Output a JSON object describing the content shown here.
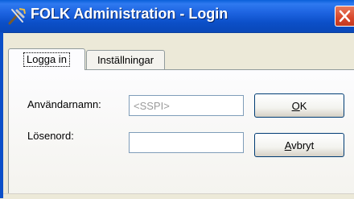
{
  "window": {
    "title": "FOLK Administration - Login",
    "app_icon": "tools-icon",
    "close_icon": "close-icon"
  },
  "tabs": [
    {
      "label": "Logga in",
      "active": true
    },
    {
      "label": "Inställningar",
      "active": false
    }
  ],
  "form": {
    "username_label": "Användarnamn:",
    "username_value": "<SSPI>",
    "password_label": "Lösenord:",
    "password_value": ""
  },
  "buttons": {
    "ok_label": "OK",
    "ok_mnemonic": "O",
    "cancel_label": "Avbryt",
    "cancel_mnemonic": "A"
  },
  "colors": {
    "titlebar": "#0b4fc8",
    "close": "#d8462a",
    "dialog_bg": "#ece9d8"
  }
}
